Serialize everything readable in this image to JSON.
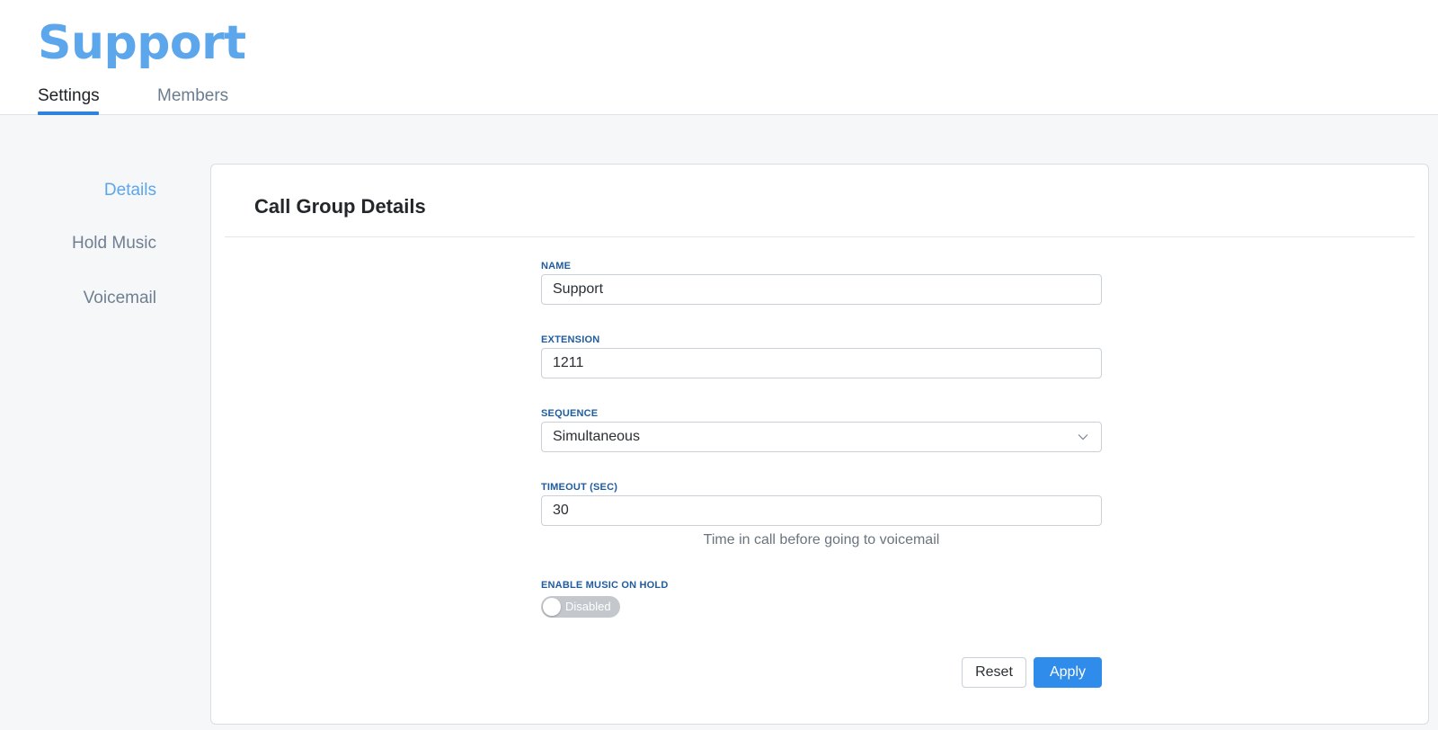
{
  "header": {
    "title": "Support",
    "tabs": [
      {
        "label": "Settings",
        "active": true
      },
      {
        "label": "Members",
        "active": false
      }
    ]
  },
  "sidebar": {
    "items": [
      {
        "label": "Details",
        "active": true
      },
      {
        "label": "Hold Music",
        "active": false
      },
      {
        "label": "Voicemail",
        "active": false
      }
    ]
  },
  "card": {
    "title": "Call Group Details",
    "fields": {
      "name": {
        "label": "NAME",
        "value": "Support"
      },
      "extension": {
        "label": "EXTENSION",
        "value": "1211"
      },
      "sequence": {
        "label": "SEQUENCE",
        "value": "Simultaneous"
      },
      "timeout": {
        "label": "TIMEOUT (SEC)",
        "value": "30",
        "help": "Time in call before going to voicemail"
      },
      "music_on_hold": {
        "label": "ENABLE MUSIC ON HOLD",
        "state": "Disabled",
        "enabled": false
      }
    },
    "buttons": {
      "reset": "Reset",
      "apply": "Apply"
    }
  },
  "colors": {
    "accent": "#2f8ceb",
    "title": "#5ca6ec",
    "label": "#1f5c9e"
  }
}
